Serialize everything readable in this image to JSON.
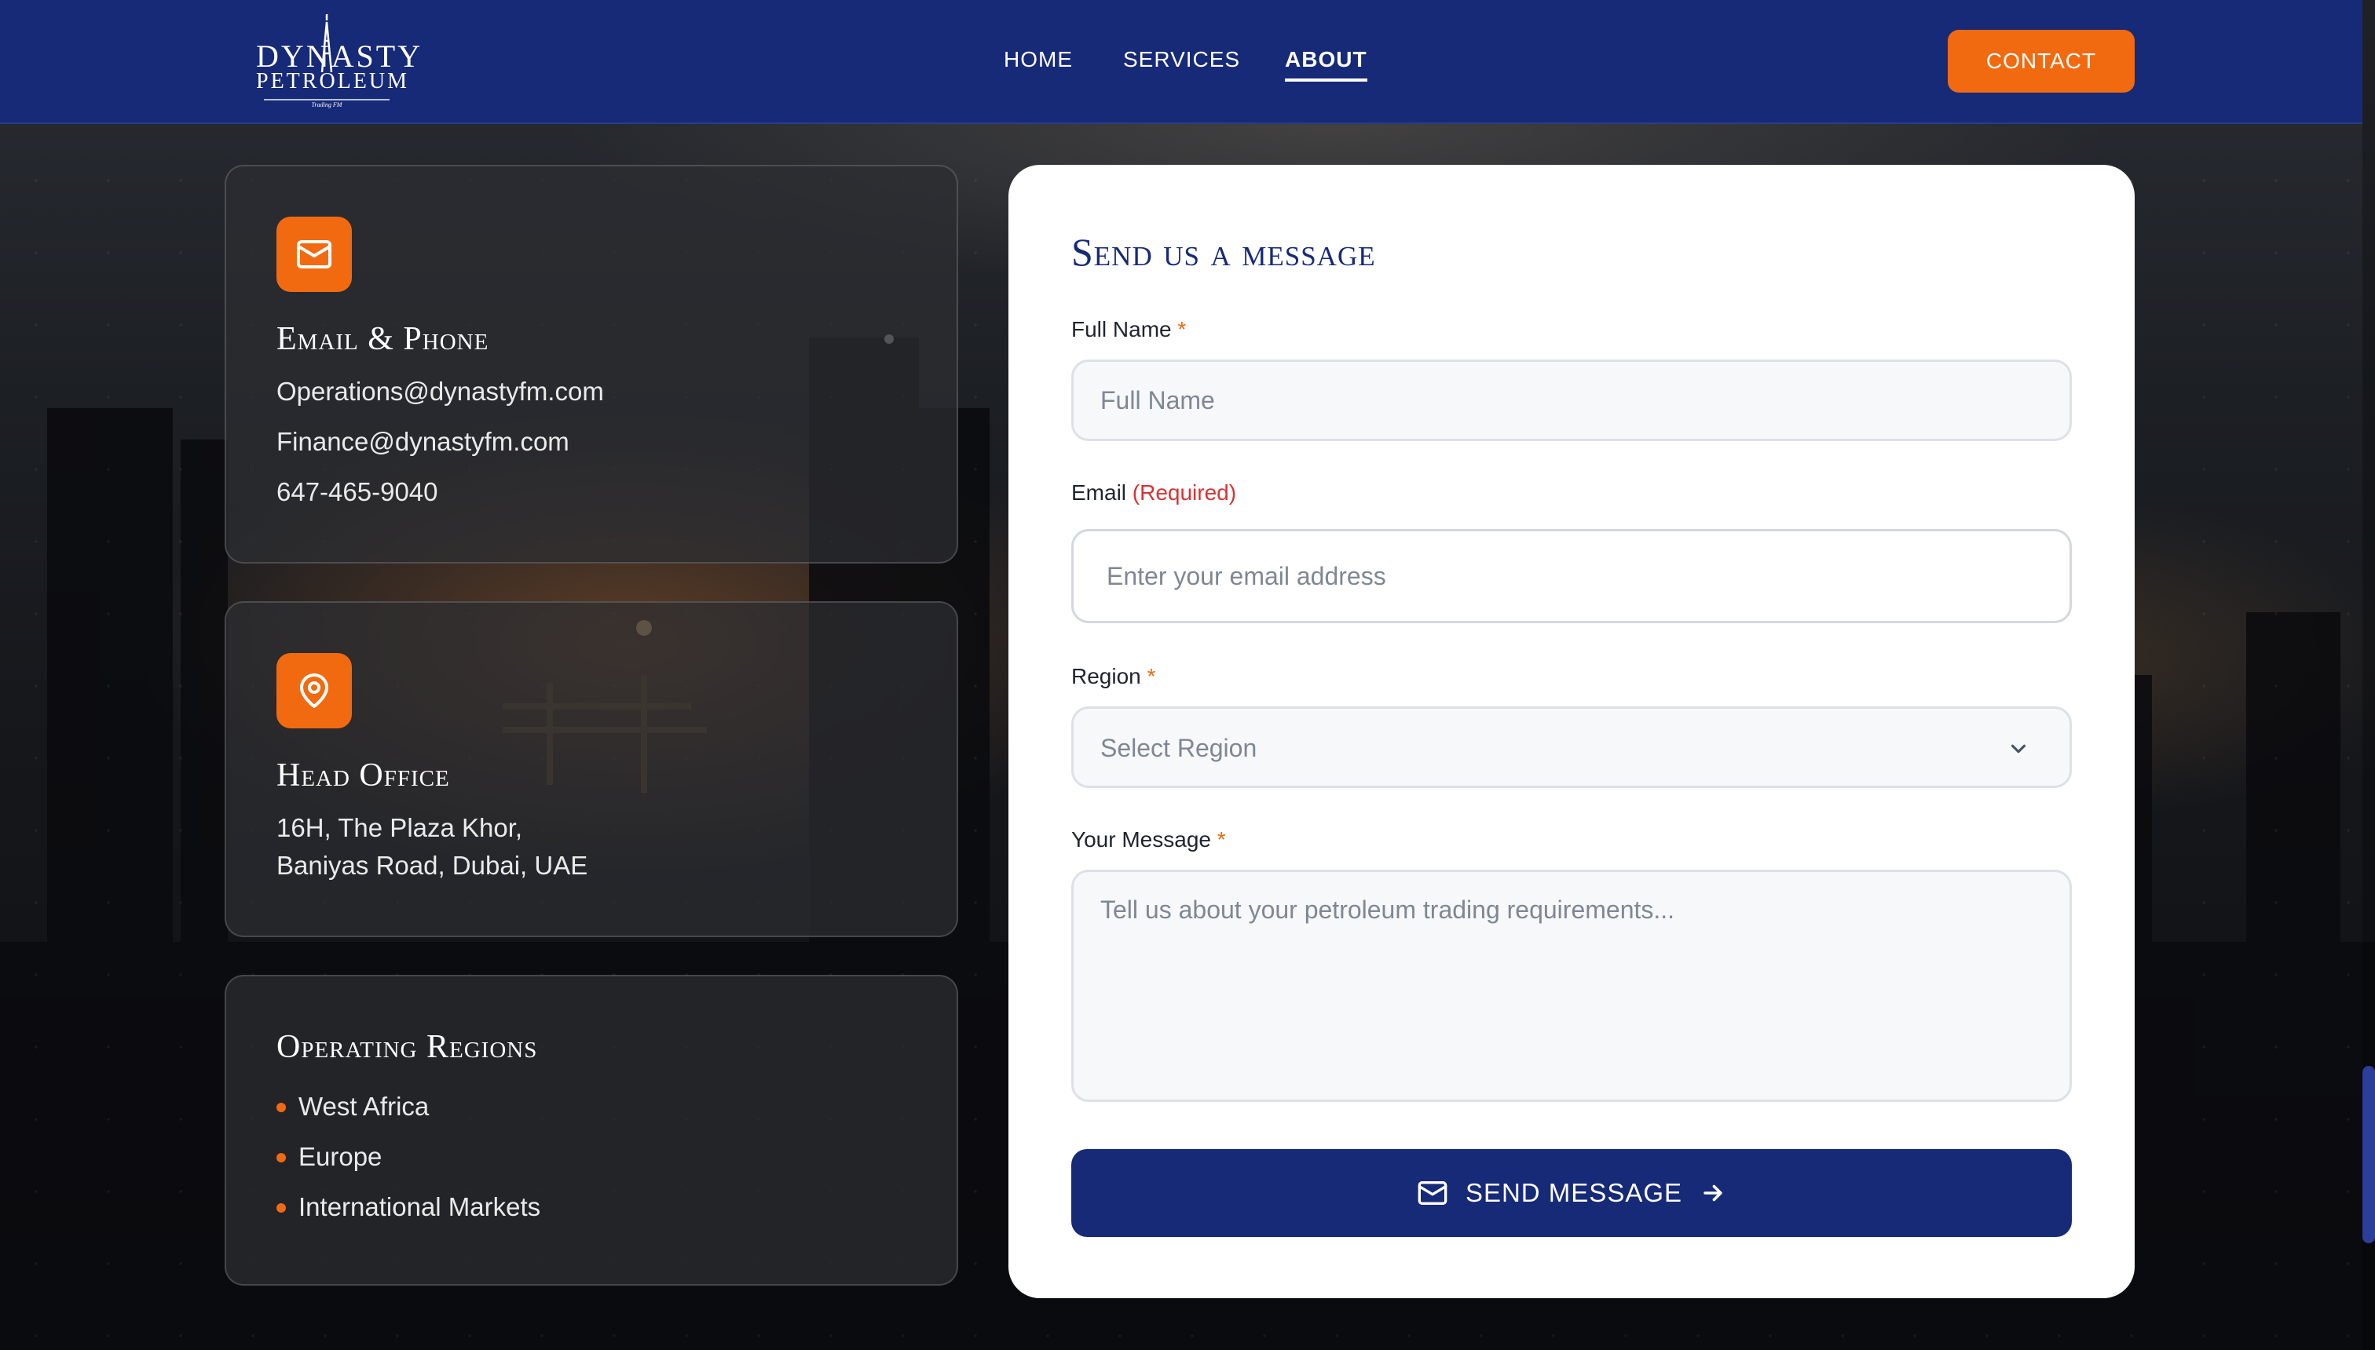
{
  "brand": {
    "name_line1": "DYNASTY",
    "name_line2": "PETROLEUM",
    "tagline": "Trading FM"
  },
  "nav": {
    "items": [
      {
        "label": "HOME",
        "active": false
      },
      {
        "label": "SERVICES",
        "active": false
      },
      {
        "label": "ABOUT",
        "active": true
      }
    ],
    "contact_label": "CONTACT"
  },
  "cards": {
    "email_phone": {
      "icon": "mail-icon",
      "title": "Email & Phone",
      "lines": [
        "Operations@dynastyfm.com",
        "Finance@dynastyfm.com",
        "647-465-9040"
      ]
    },
    "head_office": {
      "icon": "map-pin-icon",
      "title": "Head Office",
      "lines": [
        "16H, The Plaza Khor,",
        "Baniyas Road, Dubai, UAE"
      ]
    },
    "regions": {
      "title": "Operating Regions",
      "items": [
        "West Africa",
        "Europe",
        "International Markets"
      ]
    }
  },
  "form": {
    "title": "Send us a message",
    "full_name": {
      "label": "Full Name",
      "required_mark": "*",
      "placeholder": "Full Name",
      "value": ""
    },
    "email": {
      "label": "Email",
      "required_text": "(Required)",
      "placeholder": "Enter your email address",
      "value": ""
    },
    "region": {
      "label": "Region",
      "required_mark": "*",
      "placeholder": "Select Region"
    },
    "message": {
      "label": "Your Message",
      "required_mark": "*",
      "placeholder": "Tell us about your petroleum trading requirements...",
      "value": ""
    },
    "submit_label": "SEND MESSAGE"
  },
  "colors": {
    "brand_navy": "#172a78",
    "accent_orange": "#f26a10",
    "required_red": "#d63333"
  }
}
